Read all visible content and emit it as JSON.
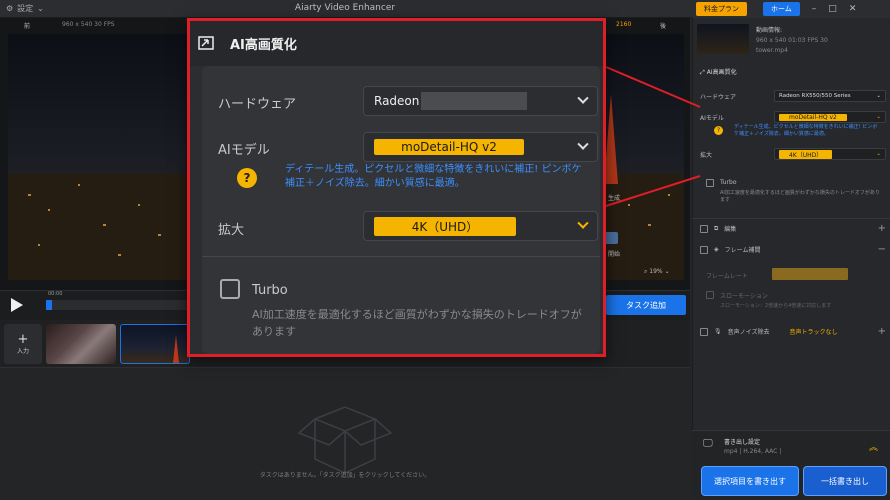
{
  "app": {
    "title": "Aiarty Video Enhancer",
    "settings_label": "設定",
    "plan_button": "料金プラン",
    "home_button": "ホーム"
  },
  "viewer": {
    "label_left": "前",
    "label_right": "後",
    "info": "960 x 540  30 FPS",
    "zoom": "19%",
    "timestamp": "00:00",
    "add_task": "タスク追加",
    "side_label": "生成",
    "side_label2": "開始",
    "res_tag": "2160"
  },
  "thumbs": {
    "add_label": "入力",
    "empty_text": "タスクはありません。「タスク追加」をクリックしてください。"
  },
  "overlay": {
    "title": "AI高画質化",
    "hw_label": "ハードウェア",
    "hw_value": "Radeon",
    "model_label": "AIモデル",
    "model_value": "moDetail-HQ  v2",
    "hint": "ディテール生成。ピクセルと微細な特徴をきれいに補正! ピンボケ補正＋ノイズ除去。細かい質感に最適。",
    "scale_label": "拡大",
    "scale_value": "4K（UHD）",
    "turbo_label": "Turbo",
    "turbo_desc": "AI加工速度を最適化するほど画質がわずかな損失のトレードオフがあります"
  },
  "panel": {
    "video_info_title": "動画情報:",
    "video_info_res": "960 x 540  01:03  FPS 30",
    "video_info_file": "tower.mp4",
    "ai_title": "AI高画質化",
    "hw_label": "ハードウェア",
    "hw_value": "Radeon RX550/550 Series",
    "model_label": "AIモデル",
    "model_value": "moDetail-HQ  v2",
    "hint": "ディテール生成。ピクセルと微細な特徴をきれいに補正! ピンボケ補正＋ノイズ除去。細かい質感に最適。",
    "scale_label": "拡大",
    "scale_value": "4K（UHD）",
    "turbo_label": "Turbo",
    "turbo_desc": "AI加工速度を最適化するほど画質がわずかな損失のトレードオフがあります",
    "edit_label": "編集",
    "frame_label": "フレーム補間",
    "frame_rate_label": "フレームレート",
    "slowmo_label": "スローモーション",
    "slowmo_desc": "スローモーション：2倍速から4倍速に対応します",
    "noise_label": "音声ノイズ除去",
    "noise_value": "音声トラックなし",
    "export_label": "書き出し設定",
    "export_value": "mp4 | H.264, AAC |",
    "export_selected": "選択項目を書き出す",
    "export_all": "一括書き出し"
  },
  "colors": {
    "accent": "#1a73e8",
    "highlight": "#f5b400",
    "callout": "#e01e26",
    "hint": "#3d8fff"
  }
}
